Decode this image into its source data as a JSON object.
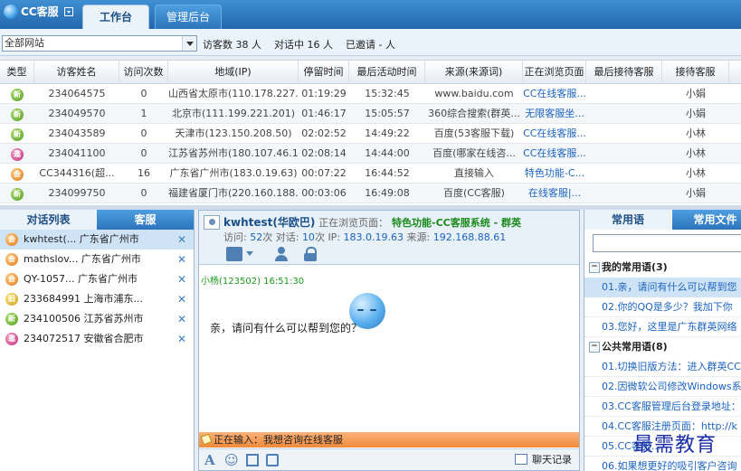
{
  "app": {
    "title": "CC客服"
  },
  "tabs": [
    {
      "label": "工作台"
    },
    {
      "label": "管理后台"
    }
  ],
  "filter": {
    "site_value": "全部网站",
    "visitors_label": "访客数",
    "visitors_count": "38",
    "visitors_unit": "人",
    "chatting_label": "对话中",
    "chatting_count": "16",
    "chatting_unit": "人",
    "invited_label": "已邀请",
    "invited_value": "-",
    "invited_unit": "人"
  },
  "grid": {
    "headers": [
      "类型",
      "访客姓名",
      "访问次数",
      "地域(IP)",
      "停留时间",
      "最后活动时间",
      "来源(来源词)",
      "正在浏览页面",
      "最后接待客服",
      "接待客服"
    ],
    "rows": [
      {
        "type": "新",
        "type_color": "green",
        "name": "234064575",
        "visits": "0",
        "region": "山西省太原市(110.178.227.2...",
        "stay": "01:19:29",
        "last": "15:32:45",
        "source": "www.baidu.com",
        "page": "CC在线客服...",
        "last_agent": "",
        "agent": "小娟"
      },
      {
        "type": "新",
        "type_color": "green",
        "name": "234049570",
        "visits": "1",
        "region": "北京市(111.199.221.201)",
        "stay": "01:46:17",
        "last": "15:05:57",
        "source": "360综合搜索(群英...",
        "page": "无限客服坐...",
        "last_agent": "",
        "agent": "小娟"
      },
      {
        "type": "新",
        "type_color": "green",
        "name": "234043589",
        "visits": "0",
        "region": "天津市(123.150.208.50)",
        "stay": "02:02:52",
        "last": "14:49:22",
        "source": "百度(53客服下载)",
        "page": "CC在线客服...",
        "last_agent": "",
        "agent": "小林"
      },
      {
        "type": "邀",
        "type_color": "pink",
        "name": "234041100",
        "visits": "0",
        "region": "江苏省苏州市(180.107.46.19)",
        "stay": "02:08:14",
        "last": "14:44:00",
        "source": "百度(哪家在线咨...",
        "page": "CC在线客服...",
        "last_agent": "",
        "agent": "小林"
      },
      {
        "type": "会",
        "type_color": "orange",
        "name": "CC344316(超...",
        "visits": "16",
        "region": "广东省广州市(183.0.19.63)",
        "stay": "00:07:22",
        "last": "16:44:52",
        "source": "直接输入",
        "page": "特色功能-C...",
        "last_agent": "",
        "agent": "小林"
      },
      {
        "type": "新",
        "type_color": "green",
        "name": "234099750",
        "visits": "0",
        "region": "福建省厦门市(220.160.188.30)",
        "stay": "00:03:06",
        "last": "16:49:08",
        "source": "百度(CC客服)",
        "page": "在线客服|...",
        "last_agent": "",
        "agent": "小娟"
      }
    ]
  },
  "left_panel": {
    "tabs": [
      {
        "label": "对话列表"
      },
      {
        "label": "客服"
      }
    ],
    "items": [
      {
        "badge": "会",
        "badge_color": "orange",
        "text": "kwhtest(...",
        "loc": "广东省广州市",
        "selected": true
      },
      {
        "badge": "会",
        "badge_color": "orange",
        "text": "mathslov...",
        "loc": "广东省广州市"
      },
      {
        "badge": "会",
        "badge_color": "orange",
        "text": "QY-1057...",
        "loc": "广东省广州市"
      },
      {
        "badge": "旧",
        "badge_color": "yellow",
        "text": "233684991",
        "loc": "上海市浦东..."
      },
      {
        "badge": "新",
        "badge_color": "green",
        "text": "234100506",
        "loc": "江苏省苏州市"
      },
      {
        "badge": "邀",
        "badge_color": "pink",
        "text": "234072517",
        "loc": "安徽省合肥市"
      }
    ]
  },
  "chat": {
    "visitor_name": "kwhtest(华欧巴)",
    "browsing_label": "正在浏览页面：",
    "browsing_page": "特色功能-CC客服系统 - 群英",
    "visit_label": "访问:",
    "visit_count": "52",
    "visit_unit": "次",
    "talk_label": "对话:",
    "talk_count": "10",
    "talk_unit": "次",
    "ip_label": "IP:",
    "ip": "183.0.19.63",
    "source_label": "来源:",
    "source_ip": "192.168.88.61",
    "msg_meta": "小杨(123502)  16:51:30",
    "msg_text": "亲，请问有什么可以帮到您的？",
    "typing_label": "正在输入：",
    "typing_text": "我想咨询在线客服",
    "history_label": "聊天记录",
    "tool_font": "A",
    "tool_emoji": "☺"
  },
  "right_panel": {
    "tabs": [
      {
        "label": "常用语"
      },
      {
        "label": "常用文件"
      }
    ],
    "my_group": "我的常用语(3)",
    "my_items": [
      "01.亲，请问有什么可以帮到您",
      "02.你的QQ是多少？我加下你",
      "03.您好，这里是广东群英网络"
    ],
    "public_group": "公共常用语(8)",
    "public_items": [
      "01.切换旧版方法：进入群英CC",
      "02.因微软公司修改Windows系",
      "03.CC客服管理后台登录地址：",
      "04.CC客服注册页面：http://k",
      "05.CC客服…",
      "06.如果想更好的吸引客户咨询"
    ]
  },
  "watermark": "最需教育"
}
